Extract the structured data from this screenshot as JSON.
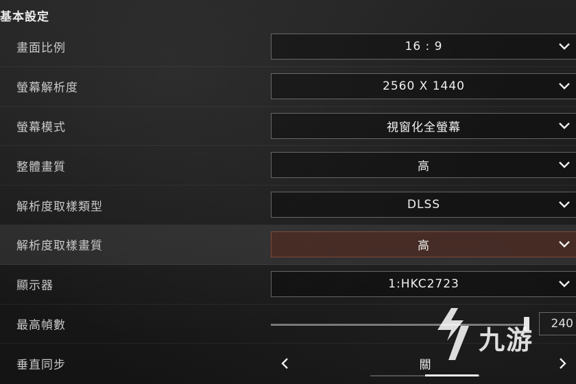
{
  "section_title": "基本設定",
  "rows": [
    {
      "label": "畫面比例",
      "value": "16 : 9"
    },
    {
      "label": "螢幕解析度",
      "value": "2560 X 1440"
    },
    {
      "label": "螢幕模式",
      "value": "視窗化全螢幕"
    },
    {
      "label": "整體畫質",
      "value": "高"
    },
    {
      "label": "解析度取樣類型",
      "value": "DLSS"
    },
    {
      "label": "解析度取樣畫質",
      "value": "高"
    },
    {
      "label": "顯示器",
      "value": "1:HKC2723"
    }
  ],
  "max_fps": {
    "label": "最高幀數",
    "value": "240"
  },
  "vsync": {
    "label": "垂直同步",
    "value": "關"
  },
  "watermark": {
    "text": "九游"
  },
  "icons": {
    "dropdown": "chevron-down-icon",
    "prev": "chevron-left-icon",
    "next": "chevron-right-icon",
    "logo": "jiuyou-logo-icon"
  },
  "colors": {
    "highlight_row": "#5a281e",
    "text": "#f0f0f0"
  }
}
